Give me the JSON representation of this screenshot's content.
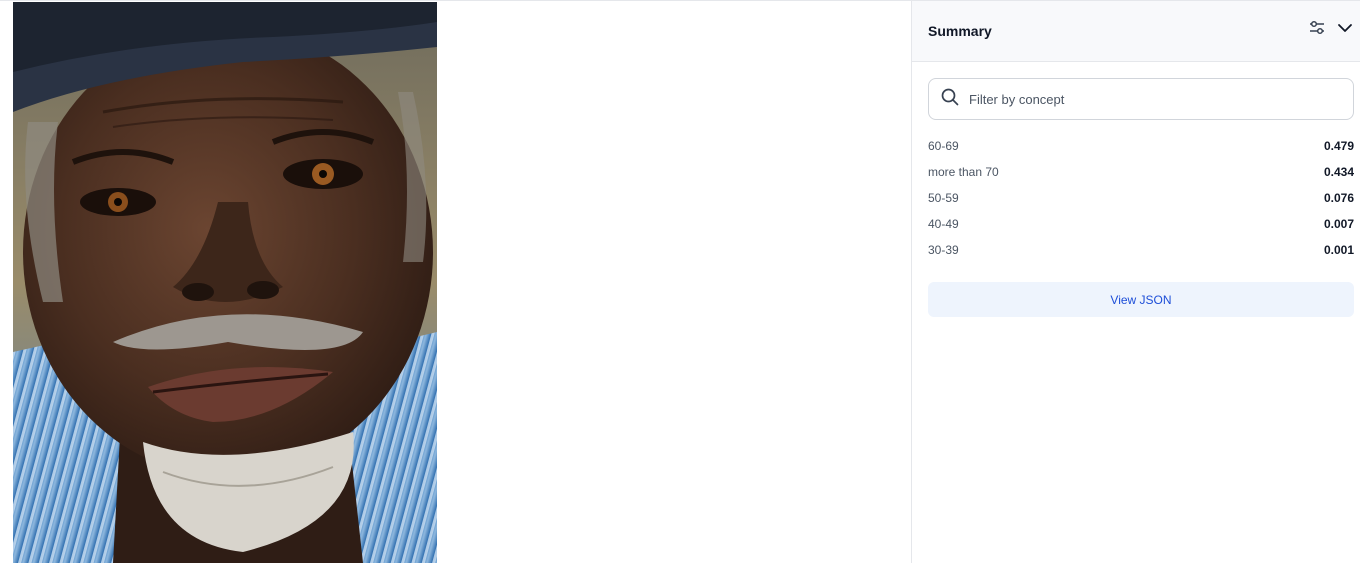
{
  "viewer": {
    "image_alt": "Portrait of an elderly man with a grey beard wearing a dark hat and blue striped shirt"
  },
  "panel": {
    "title": "Summary",
    "icons": [
      "sliders-icon",
      "chevron-down-icon"
    ]
  },
  "search": {
    "placeholder": "Filter by concept",
    "value": ""
  },
  "concepts": [
    {
      "name": "60-69",
      "value": "0.479"
    },
    {
      "name": "more than 70",
      "value": "0.434"
    },
    {
      "name": "50-59",
      "value": "0.076"
    },
    {
      "name": "40-49",
      "value": "0.007"
    },
    {
      "name": "30-39",
      "value": "0.001"
    }
  ],
  "actions": {
    "view_json_label": "View JSON"
  },
  "colors": {
    "accent": "#1d4ed8",
    "button_bg": "#eef4fd",
    "border": "#e5e7eb"
  }
}
